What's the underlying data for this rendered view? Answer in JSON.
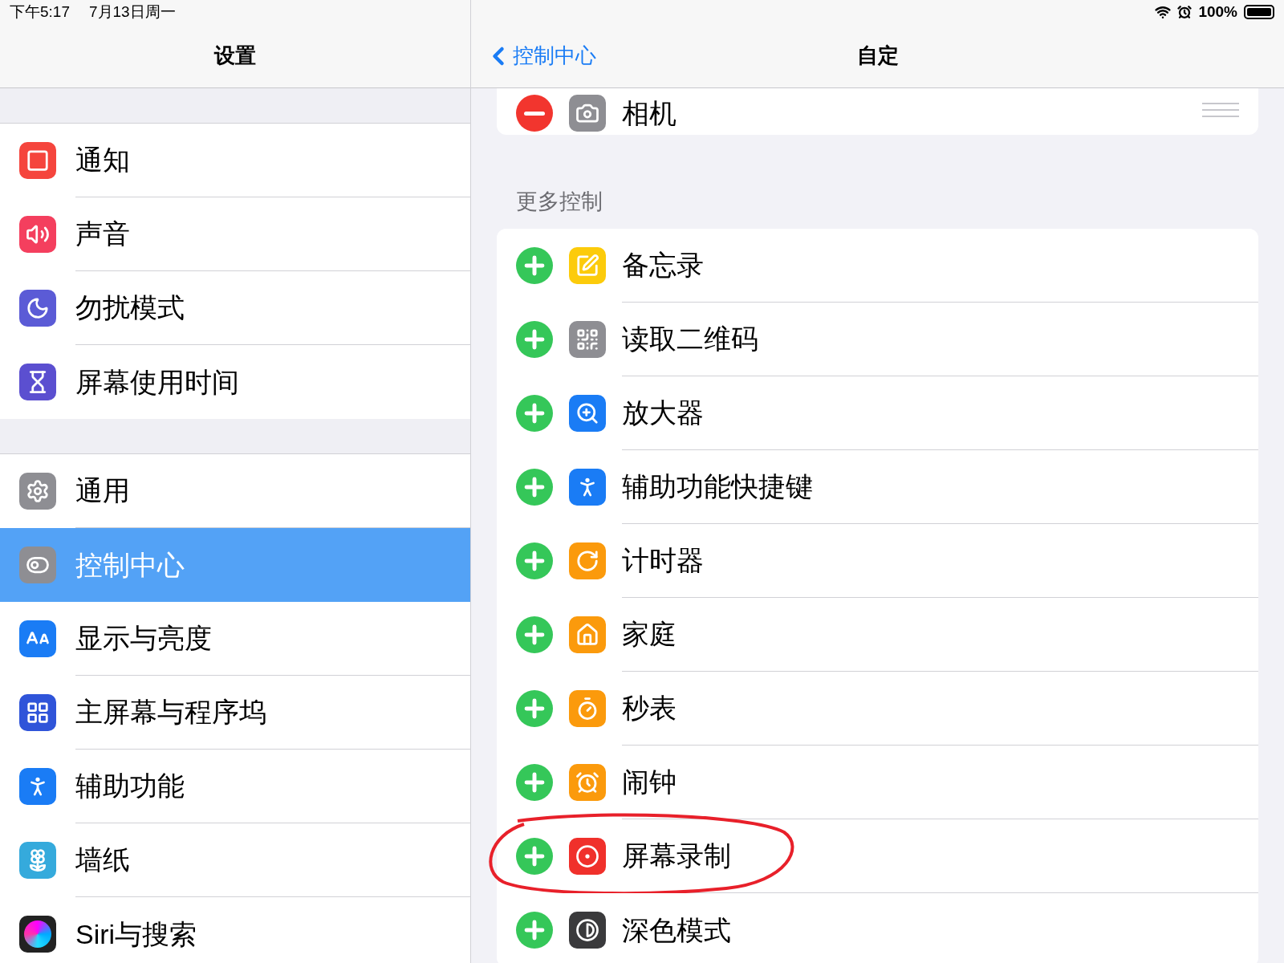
{
  "status_bar": {
    "time": "下午5:17",
    "date": "7月13日周一",
    "battery": "100%"
  },
  "sidebar": {
    "title": "设置",
    "groups": [
      {
        "items": [
          {
            "label": "通知",
            "kind": "notification",
            "color": "#f5453d",
            "selected": false
          },
          {
            "label": "声音",
            "kind": "sound",
            "color": "#f43f5e",
            "selected": false
          },
          {
            "label": "勿扰模式",
            "kind": "moon",
            "color": "#5b5bd6",
            "selected": false
          },
          {
            "label": "屏幕使用时间",
            "kind": "hourglass",
            "color": "#5b4fd0",
            "selected": false
          }
        ]
      },
      {
        "items": [
          {
            "label": "通用",
            "kind": "gear",
            "color": "#8e8e93",
            "selected": false
          },
          {
            "label": "控制中心",
            "kind": "toggles",
            "color": "#8e8e93",
            "selected": true
          },
          {
            "label": "显示与亮度",
            "kind": "text-size",
            "color": "#1a7cf5",
            "selected": false
          },
          {
            "label": "主屏幕与程序坞",
            "kind": "grid",
            "color": "#2f54d9",
            "selected": false
          },
          {
            "label": "辅助功能",
            "kind": "accessibility",
            "color": "#1a7cf5",
            "selected": false
          },
          {
            "label": "墙纸",
            "kind": "flower",
            "color": "#35aadc",
            "selected": false
          },
          {
            "label": "Siri与搜索",
            "kind": "siri",
            "color": "#222222",
            "selected": false
          }
        ]
      }
    ]
  },
  "detail": {
    "back": "控制中心",
    "title": "自定",
    "included": [
      {
        "label": "相机",
        "kind": "camera",
        "color": "#8e8e93"
      }
    ],
    "more": {
      "heading": "更多控制",
      "items": [
        {
          "label": "备忘录",
          "kind": "note",
          "color": "#fccb0b",
          "highlighted": false
        },
        {
          "label": "读取二维码",
          "kind": "qr",
          "color": "#8e8e93",
          "highlighted": false
        },
        {
          "label": "放大器",
          "kind": "zoom",
          "color": "#1a7cf5",
          "highlighted": false
        },
        {
          "label": "辅助功能快捷键",
          "kind": "accessibility",
          "color": "#1a7cf5",
          "highlighted": false
        },
        {
          "label": "计时器",
          "kind": "timer",
          "color": "#fb9a0c",
          "highlighted": false
        },
        {
          "label": "家庭",
          "kind": "home",
          "color": "#fb9a0c",
          "highlighted": false
        },
        {
          "label": "秒表",
          "kind": "stopwatch",
          "color": "#fb9a0c",
          "highlighted": false
        },
        {
          "label": "闹钟",
          "kind": "alarm",
          "color": "#fb9a0c",
          "highlighted": false
        },
        {
          "label": "屏幕录制",
          "kind": "record",
          "color": "#f0302b",
          "highlighted": true
        },
        {
          "label": "深色模式",
          "kind": "contrast",
          "color": "#3a3a3c",
          "highlighted": false
        }
      ]
    }
  }
}
